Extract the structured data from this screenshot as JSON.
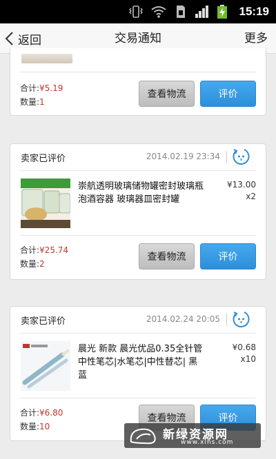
{
  "statusbar": {
    "time": "15:19",
    "icons": [
      "vibrate-icon",
      "wifi-icon",
      "sim-icon",
      "signal-icon",
      "battery-charging-icon"
    ]
  },
  "navbar": {
    "back_label": "返回",
    "title": "交易通知",
    "more_label": "更多"
  },
  "orders": [
    {
      "total_label": "合计:",
      "total": "¥5.19",
      "count_label": "数量:",
      "count": "1",
      "logistics_label": "查看物流",
      "review_label": "评价"
    },
    {
      "status": "卖家已评价",
      "time": "2014.02.19 23:34",
      "product": "崇航透明玻璃储物罐密封玻璃瓶 泡酒容器 玻璃器皿密封罐",
      "price": "¥13.00",
      "qty": "x2",
      "total_label": "合计:",
      "total": "¥25.74",
      "count_label": "数量:",
      "count": "2",
      "logistics_label": "查看物流",
      "review_label": "评价"
    },
    {
      "status": "卖家已评价",
      "time": "2014.02.24 20:05",
      "product": "晨光 新款 晨光优品0.35全针管中性笔芯|水笔芯|中性替芯| 黑 蓝",
      "price": "¥0.68",
      "qty": "x10",
      "total_label": "合计:",
      "total": "¥6.80",
      "count_label": "数量:",
      "count": "10",
      "logistics_label": "查看物流",
      "review_label": "评价"
    }
  ],
  "colors": {
    "price_red": "#c0352c",
    "review_blue": "#2b8fdb",
    "nav_bg": "#f7f7f7"
  },
  "watermark": {
    "text": "新绿资源网",
    "url": "www.xlhs.com"
  }
}
